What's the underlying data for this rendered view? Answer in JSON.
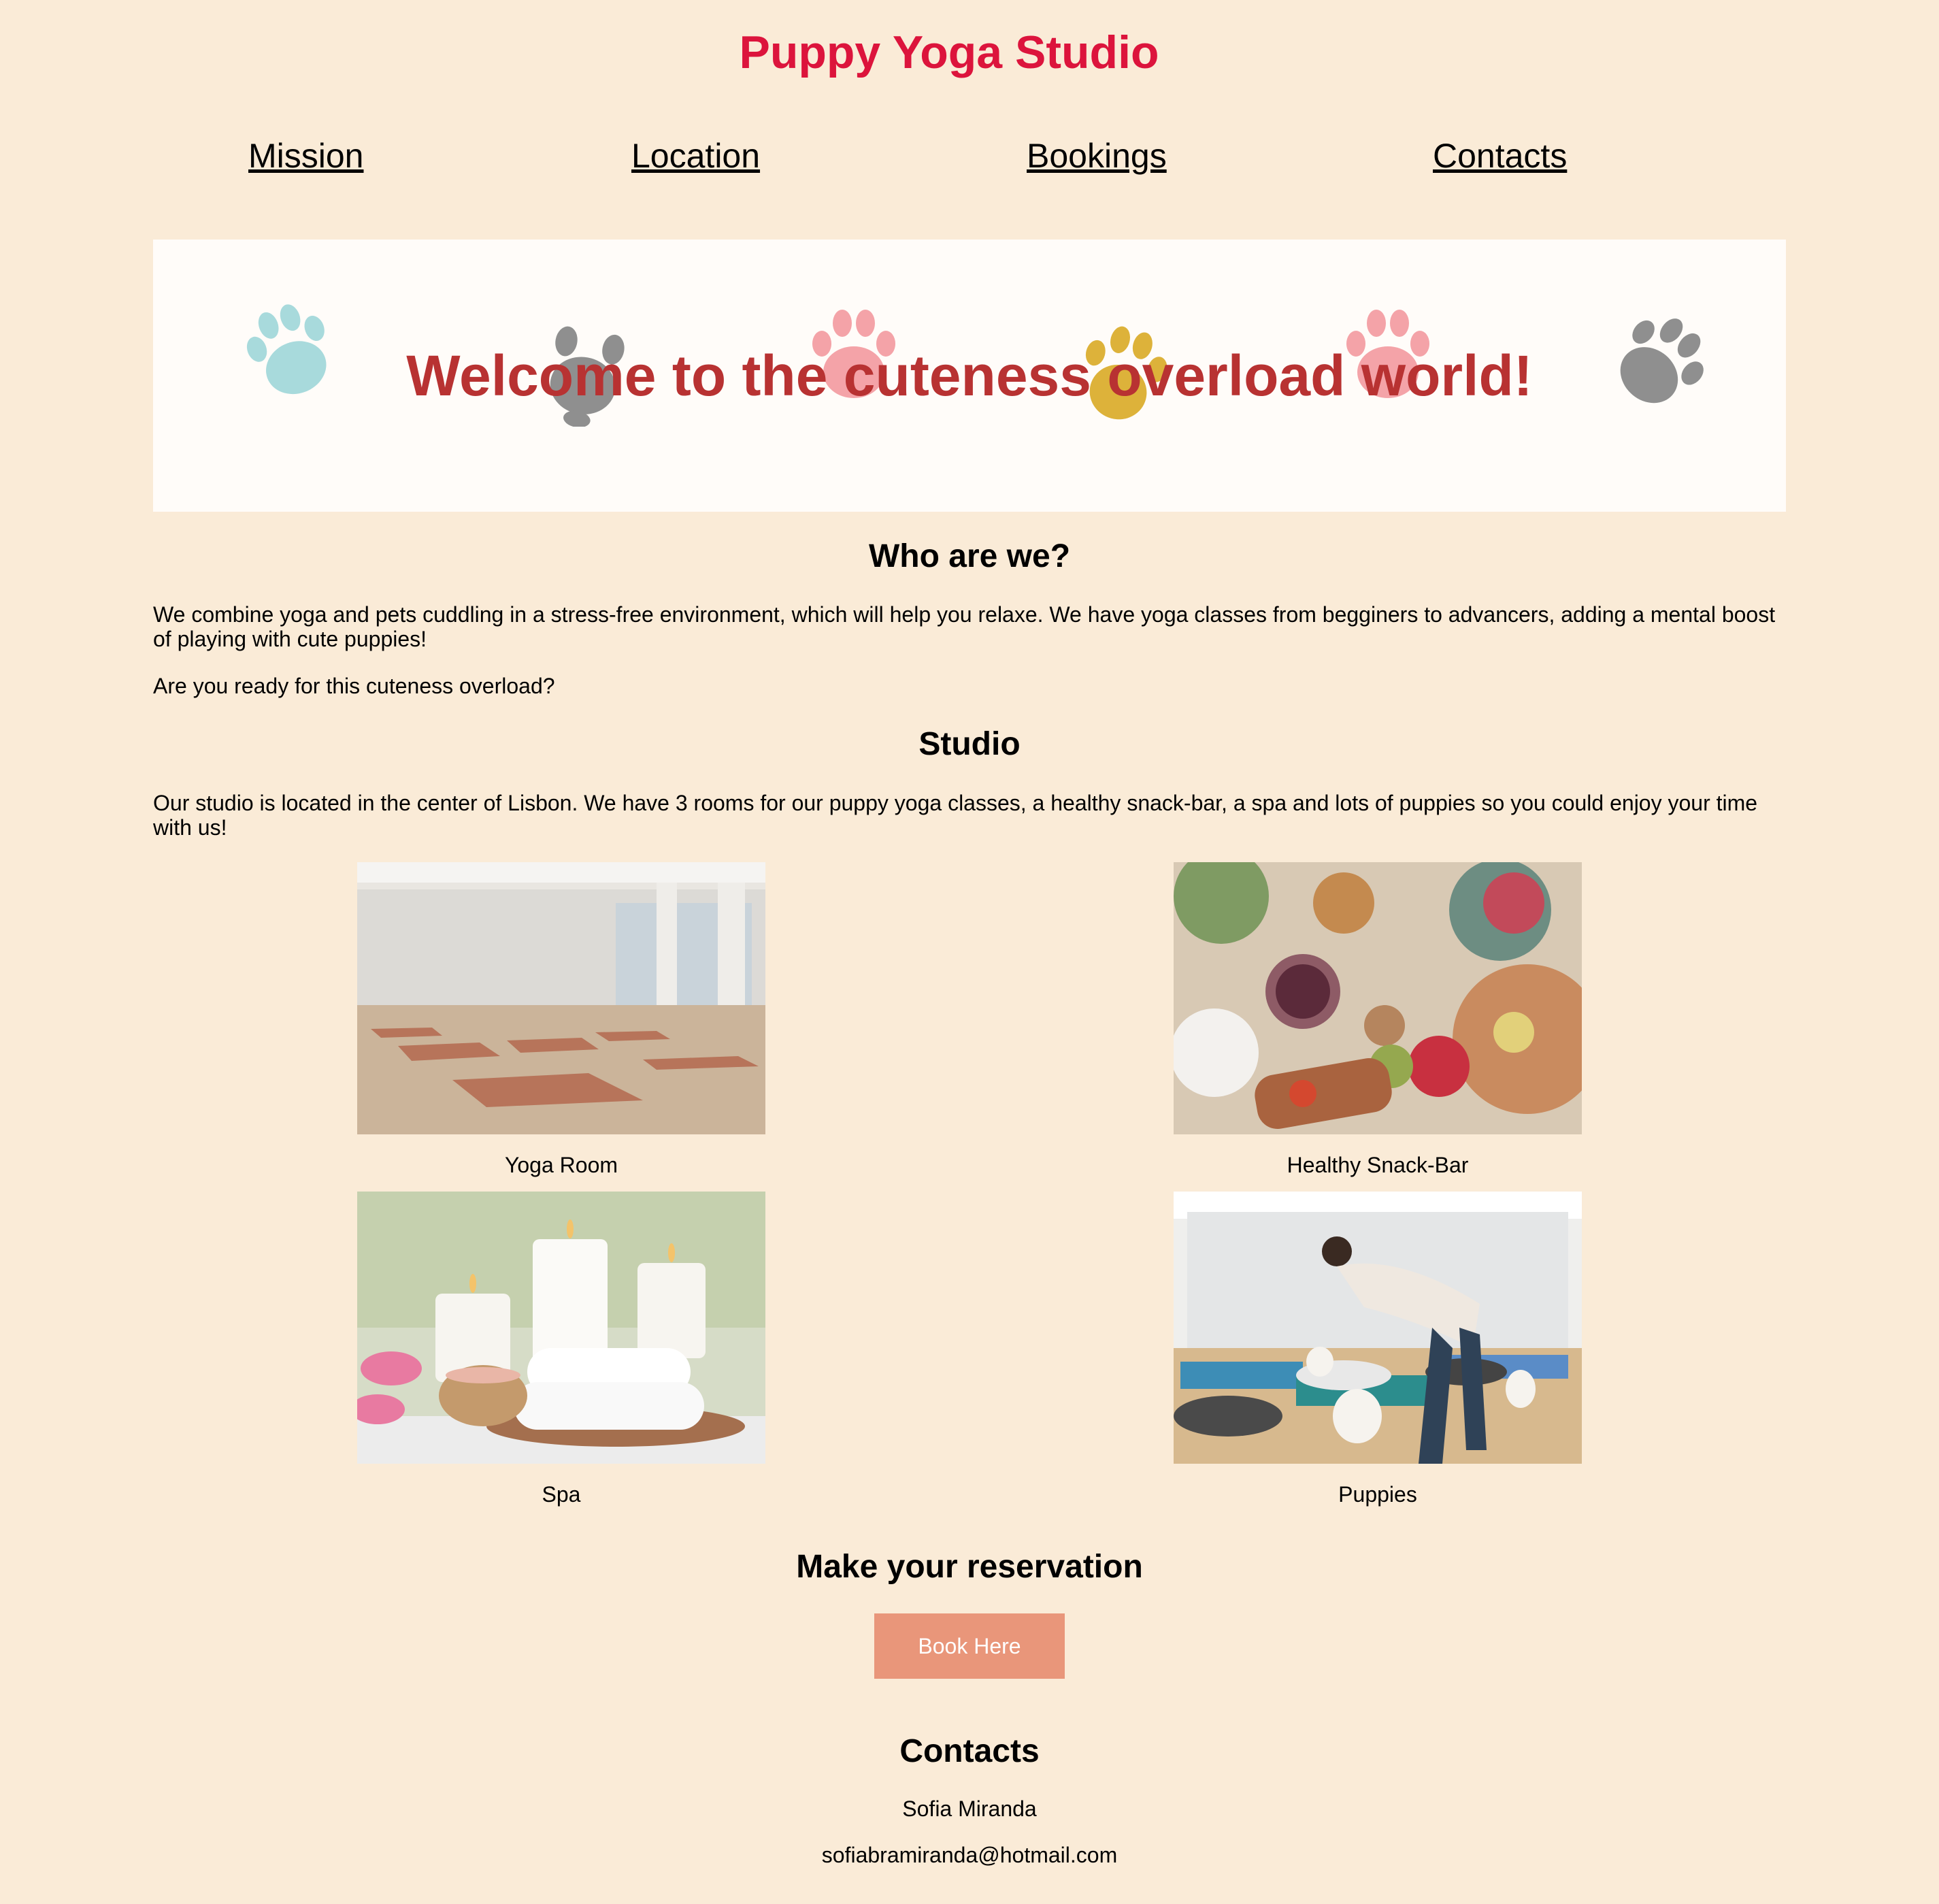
{
  "header": {
    "title": "Puppy Yoga Studio"
  },
  "nav": [
    {
      "label": "Mission"
    },
    {
      "label": "Location"
    },
    {
      "label": "Bookings"
    },
    {
      "label": "Contacts"
    }
  ],
  "banner": {
    "text": "Welcome to the cuteness overload world!"
  },
  "about": {
    "heading": "Who are we?",
    "paragraph1": "We combine yoga and pets cuddling in a stress-free environment, which will help you relaxe. We have yoga classes from begginers to advancers, adding a mental boost of playing with cute puppies!",
    "paragraph2": "Are you ready for this cuteness overload?"
  },
  "studio": {
    "heading": "Studio",
    "paragraph": "Our studio is located in the center of Lisbon. We have 3 rooms for our puppy yoga classes, a healthy snack-bar, a spa and lots of puppies so you could enjoy your time with us!",
    "gallery": [
      {
        "caption": "Yoga Room"
      },
      {
        "caption": "Healthy Snack-Bar"
      },
      {
        "caption": "Spa"
      },
      {
        "caption": "Puppies"
      }
    ]
  },
  "reservation": {
    "heading": "Make your reservation",
    "button_label": "Book Here"
  },
  "contacts": {
    "heading": "Contacts",
    "name": "Sofia Miranda",
    "email": "sofiabramiranda@hotmail.com"
  },
  "colors": {
    "background": "#faebd7",
    "title": "#dc143c",
    "banner_text": "#b83232",
    "button": "#e9967a"
  }
}
